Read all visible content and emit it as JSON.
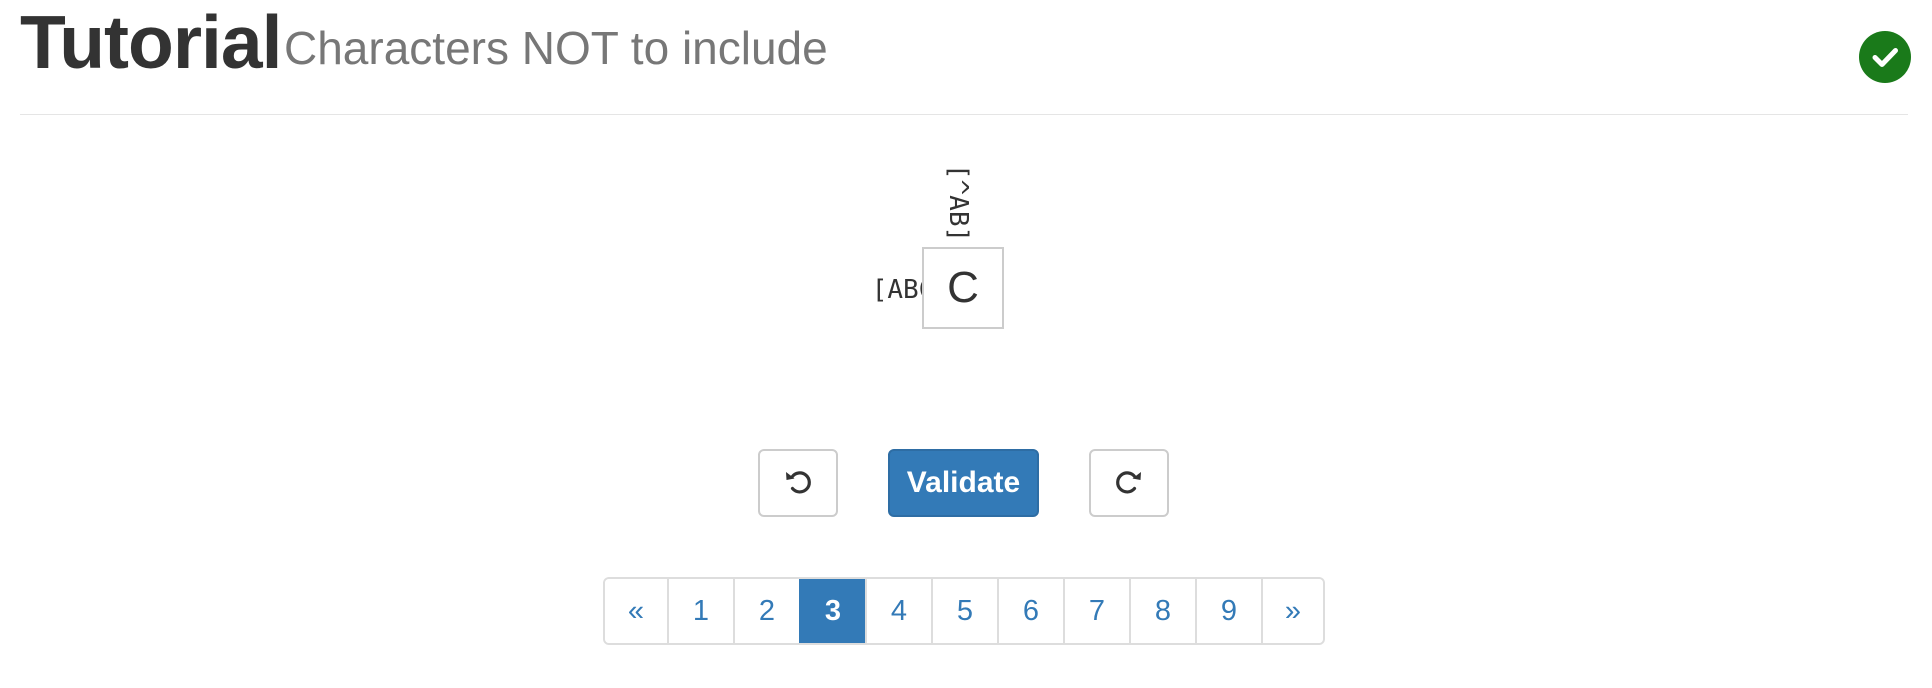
{
  "header": {
    "title": "Tutorial",
    "subtitle": "Characters NOT to include",
    "solved_icon": "check-circle-icon",
    "solved_color": "#1a7a1a"
  },
  "puzzle": {
    "column_clue": "[^AB]",
    "row_clue": "[ABC]",
    "cell_value": "C"
  },
  "controls": {
    "undo_icon": "undo-icon",
    "validate_label": "Validate",
    "redo_icon": "redo-icon",
    "accent_color": "#337ab7"
  },
  "pagination": {
    "prev_label": "«",
    "next_label": "»",
    "pages": [
      "1",
      "2",
      "3",
      "4",
      "5",
      "6",
      "7",
      "8",
      "9"
    ],
    "current_page": "3"
  }
}
